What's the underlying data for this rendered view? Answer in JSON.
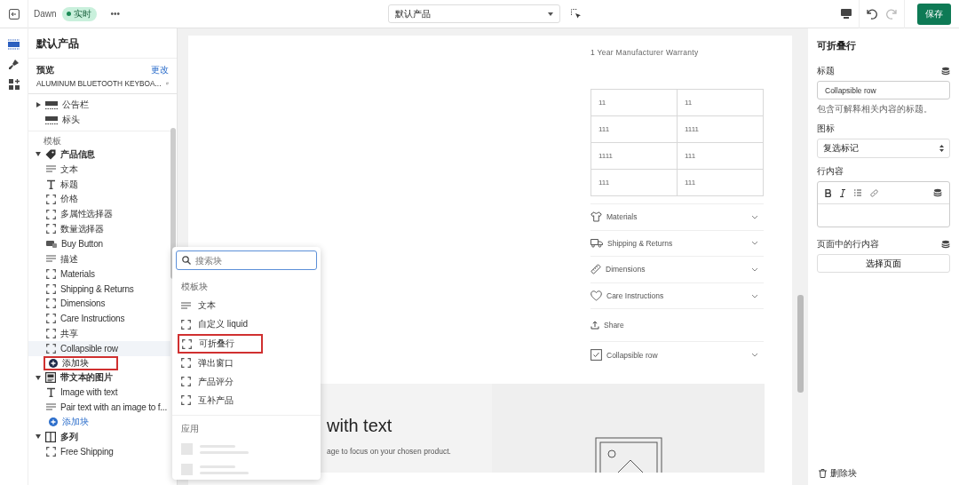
{
  "topbar": {
    "theme": "Dawn",
    "status": "实时",
    "more": "•••",
    "template_select": "默认产品",
    "save": "保存"
  },
  "sidebar": {
    "title": "默认产品",
    "preview_label": "预览",
    "change_link": "更改",
    "preview_product": "ALUMINUM BLUETOOTH KEYBOA...",
    "header_sections": [
      {
        "label": "公告栏",
        "expanded": false
      },
      {
        "label": "标头"
      }
    ],
    "template_label": "模板",
    "groups": [
      {
        "label": "产品信息",
        "kind": "tag",
        "expanded": true,
        "children": [
          {
            "label": "文本",
            "kind": "text",
            "selected": false
          },
          {
            "label": "标题",
            "kind": "heading",
            "selected": false
          },
          {
            "label": "价格",
            "kind": "block",
            "selected": false
          },
          {
            "label": "多属性选择器",
            "kind": "block",
            "selected": false
          },
          {
            "label": "数量选择器",
            "kind": "block",
            "selected": false
          },
          {
            "label": "Buy Button",
            "kind": "buy",
            "selected": false
          },
          {
            "label": "描述",
            "kind": "text",
            "selected": false
          },
          {
            "label": "Materials",
            "kind": "block",
            "selected": false
          },
          {
            "label": "Shipping & Returns",
            "kind": "block",
            "selected": false
          },
          {
            "label": "Dimensions",
            "kind": "block",
            "selected": false
          },
          {
            "label": "Care Instructions",
            "kind": "block",
            "selected": false
          },
          {
            "label": "共享",
            "kind": "block",
            "selected": false
          },
          {
            "label": "Collapsible row",
            "kind": "block",
            "selected": true
          }
        ],
        "add_block": {
          "label": "添加块",
          "highlighted": true
        }
      },
      {
        "label": "带文本的图片",
        "kind": "image-text",
        "expanded": true,
        "children": [
          {
            "label": "Image with text",
            "kind": "heading",
            "selected": false
          },
          {
            "label": "Pair text with an image to f...",
            "kind": "text",
            "selected": false
          }
        ],
        "add_block": {
          "label": "添加块",
          "highlighted": false
        }
      },
      {
        "label": "多列",
        "kind": "columns",
        "expanded": true,
        "children": [
          {
            "label": "Free Shipping",
            "kind": "block",
            "selected": false
          }
        ]
      }
    ]
  },
  "preview": {
    "warranty": "1 Year Manufacturer Warranty",
    "spec_table": [
      [
        "11",
        "11"
      ],
      [
        "111",
        "1111"
      ],
      [
        "1111",
        "111"
      ],
      [
        "111",
        "111"
      ]
    ],
    "rows": [
      {
        "label": "Materials",
        "kind": "shirt"
      },
      {
        "label": "Shipping & Returns",
        "kind": "truck"
      },
      {
        "label": "Dimensions",
        "kind": "ruler"
      },
      {
        "label": "Care Instructions",
        "kind": "heart"
      },
      {
        "label": "Share",
        "kind": "share"
      },
      {
        "label": "Collapsible row",
        "kind": "checkbox"
      }
    ],
    "image_text_heading": "with text",
    "image_text_body": "age to focus on your chosen product."
  },
  "block_picker": {
    "placeholder": "搜索块",
    "section": "模板块",
    "items": [
      {
        "label": "文本",
        "kind": "text",
        "highlighted": false
      },
      {
        "label": "自定义 liquid",
        "kind": "block",
        "highlighted": false
      },
      {
        "label": "可折叠行",
        "kind": "block",
        "highlighted": true
      },
      {
        "label": "弹出窗口",
        "kind": "block",
        "highlighted": false
      },
      {
        "label": "产品评分",
        "kind": "block",
        "highlighted": false
      },
      {
        "label": "互补产品",
        "kind": "block",
        "highlighted": false
      }
    ],
    "apps_section": "应用"
  },
  "settings": {
    "title": "可折叠行",
    "heading_label": "标题",
    "heading_value": "Collapsible row",
    "heading_hint": "包含可解释相关内容的标题。",
    "icon_label": "图标",
    "icon_value": "复选标记",
    "content_label": "行内容",
    "page_content_label": "页面中的行内容",
    "select_page": "选择页面",
    "delete": "删除块"
  }
}
